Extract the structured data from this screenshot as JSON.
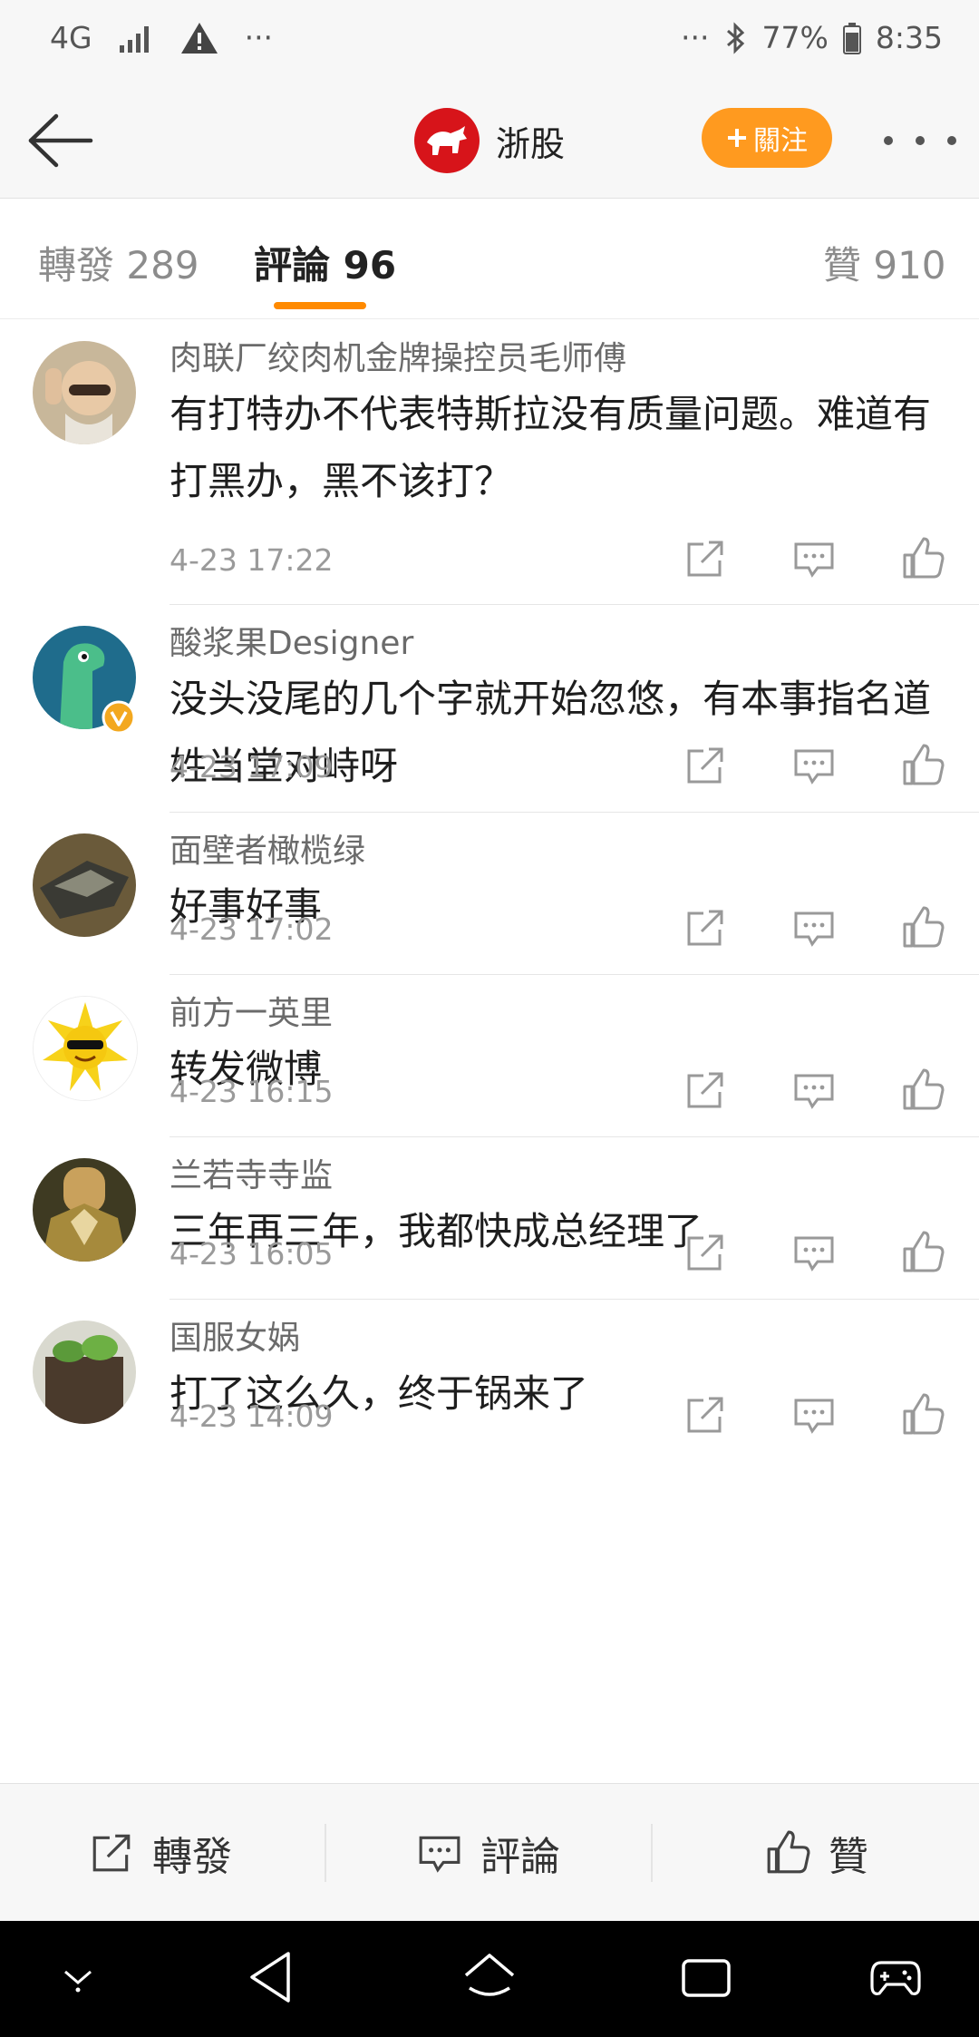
{
  "status_bar": {
    "network": "4G",
    "dots_left": "···",
    "dots_right": "···",
    "battery": "77%",
    "time": "8:35"
  },
  "header": {
    "title": "浙股",
    "follow_label": "關注"
  },
  "tabs": [
    {
      "label": "轉發 289"
    },
    {
      "label": "評論 96"
    },
    {
      "label": "贊 910"
    }
  ],
  "comments": [
    {
      "user": "肉联厂绞肉机金牌操控员毛师傅",
      "text": "有打特办不代表特斯拉没有质量问题。难道有打黑办，黑不该打？",
      "time": "4-23 17:22"
    },
    {
      "user": "酸浆果Designer",
      "text": "没头没尾的几个字就开始忽悠，有本事指名道姓当堂对峙呀",
      "time": "4-23 17:09"
    },
    {
      "user": "面壁者橄榄绿",
      "text": "好事好事",
      "time": "4-23 17:02"
    },
    {
      "user": "前方一英里",
      "text": "转发微博",
      "time": "4-23 16:15"
    },
    {
      "user": "兰若寺寺监",
      "text": "三年再三年，我都快成总经理了",
      "time": "4-23 16:05"
    },
    {
      "user": "国服女娲",
      "text": "打了这么久，终于锅来了",
      "time": "4-23 14:09"
    }
  ],
  "bottom_bar": {
    "repost": "轉發",
    "comment": "評論",
    "like": "贊"
  },
  "colors": {
    "accent": "#ff8a00",
    "follow_button": "#ff9a1f",
    "logo_red": "#d7141a"
  }
}
